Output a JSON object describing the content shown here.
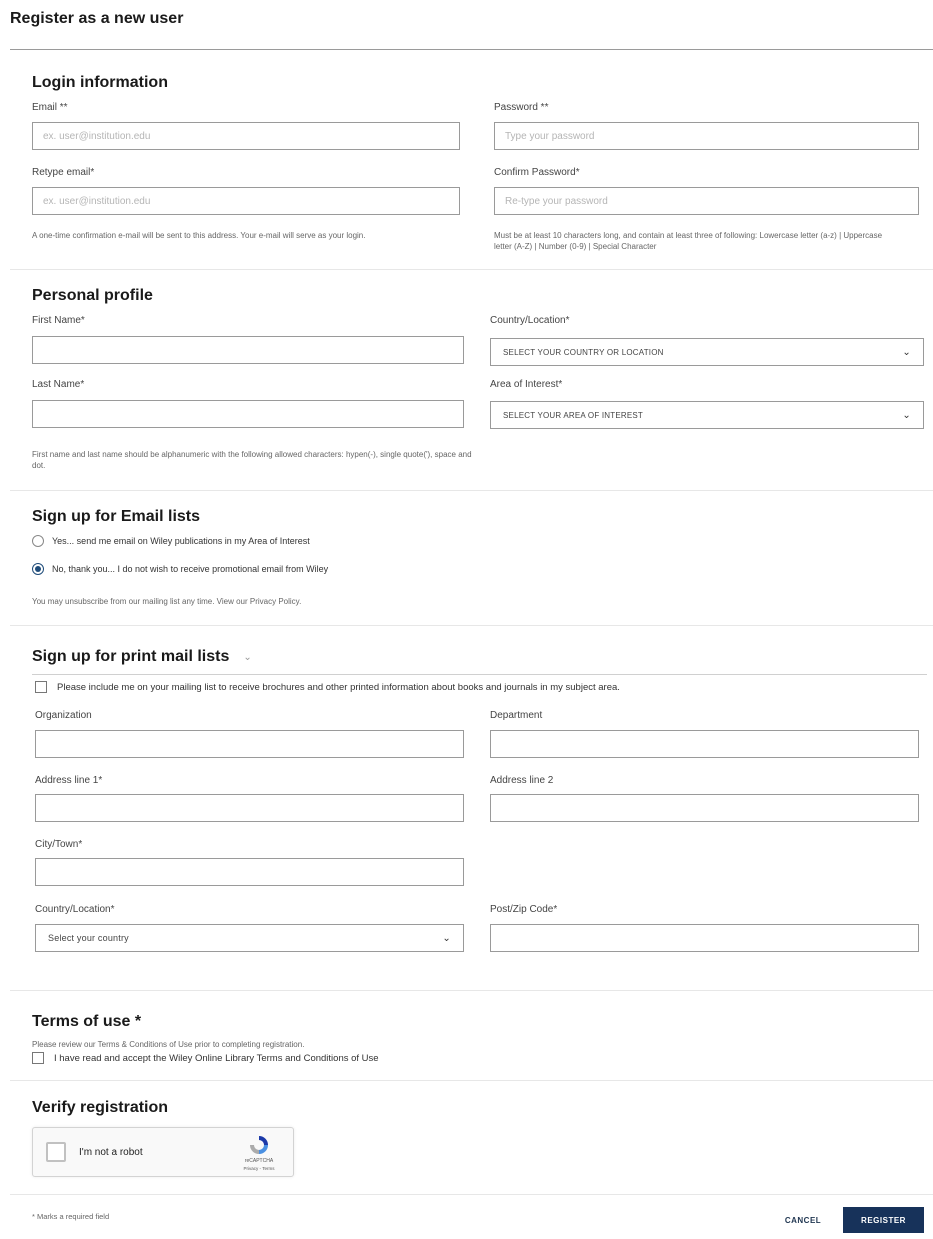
{
  "page": {
    "title": "Register as a new user"
  },
  "login": {
    "title": "Login information",
    "email_label": "Email **",
    "email_placeholder": "ex. user@institution.edu",
    "password_label": "Password **",
    "password_placeholder": "Type your password",
    "retype_email_label": "Retype email*",
    "retype_email_placeholder": "ex. user@institution.edu",
    "confirm_password_label": "Confirm Password*",
    "confirm_password_placeholder": "Re-type your password",
    "email_help": "A one-time confirmation e-mail will be sent to this address. Your e-mail will serve as your login.",
    "password_help": "Must be at least 10 characters long, and contain at least three of following: Lowercase letter (a-z) | Uppercase letter (A-Z) | Number (0-9) | Special Character"
  },
  "profile": {
    "title": "Personal profile",
    "first_name_label": "First Name*",
    "last_name_label": "Last Name*",
    "country_label": "Country/Location*",
    "country_value": "SELECT YOUR COUNTRY OR LOCATION",
    "interest_label": "Area of Interest*",
    "interest_value": "SELECT YOUR AREA OF INTEREST",
    "name_help": "First name and last name should be alphanumeric with the following allowed characters: hypen(-), single quote('), space and dot."
  },
  "email_lists": {
    "title": "Sign up for Email lists",
    "option_yes": "Yes... send me email on Wiley publications in my Area of Interest",
    "option_no": "No, thank you... I do not wish to receive promotional email from Wiley",
    "selected": "no",
    "note": "You may unsubscribe from our mailing list any time. View our Privacy Policy."
  },
  "print_lists": {
    "title": "Sign up for print mail lists",
    "checkbox_label": "Please include me on your mailing list to receive brochures and other printed information about books and journals in my subject area.",
    "organization_label": "Organization",
    "department_label": "Department",
    "address1_label": "Address line 1*",
    "address2_label": "Address line 2",
    "city_label": "City/Town*",
    "country_label": "Country/Location*",
    "country_value": "Select your country",
    "postcode_label": "Post/Zip Code*"
  },
  "terms": {
    "title": "Terms of use *",
    "note": "Please review our Terms & Conditions of Use prior to completing registration.",
    "checkbox_label": "I have read and accept the Wiley Online Library Terms and Conditions of Use"
  },
  "verify": {
    "title": "Verify registration",
    "captcha_label": "I'm not a robot",
    "captcha_brand": "reCAPTCHA",
    "captcha_links": "Privacy - Terms"
  },
  "footer": {
    "required_note": "* Marks a required field",
    "cancel_label": "CANCEL",
    "register_label": "REGISTER"
  },
  "colors": {
    "primary": "#17325a",
    "border": "#9a9a9a",
    "radio_checked": "#1f4c7a"
  }
}
